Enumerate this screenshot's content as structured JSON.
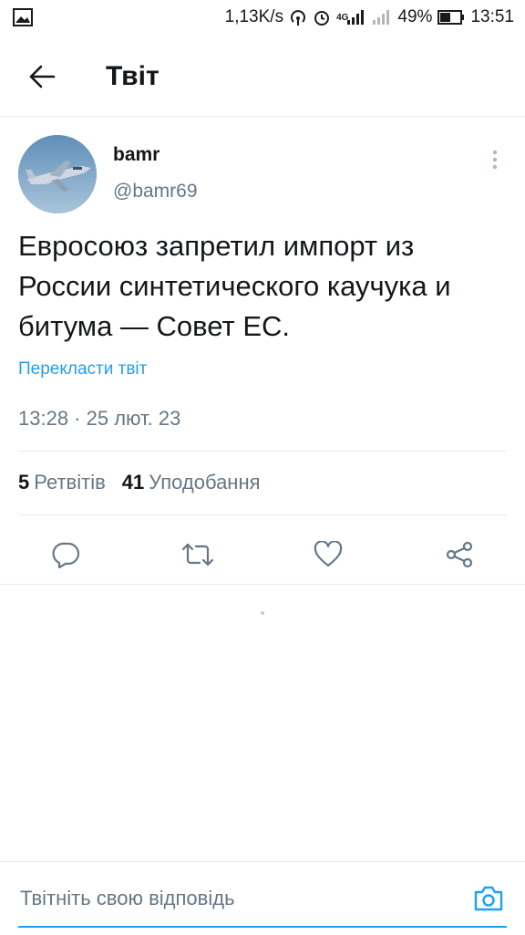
{
  "status_bar": {
    "network_speed": "1,13K/s",
    "network_type": "4G",
    "battery_percent": "49%",
    "time": "13:51"
  },
  "header": {
    "title": "Твіт"
  },
  "tweet": {
    "author_name": "bamr",
    "author_handle": "@bamr69",
    "text": "Евросоюз запретил импорт из России синтетического каучука и битума — Совет ЕС.",
    "translate_label": "Перекласти твіт",
    "timestamp": "13:28 · 25 лют. 23",
    "retweet_count": "5",
    "retweet_label": "Ретвітів",
    "like_count": "41",
    "like_label": "Уподобання"
  },
  "actions": {
    "icons": [
      "reply-icon",
      "retweet-icon",
      "like-icon",
      "share-icon"
    ]
  },
  "reply": {
    "placeholder": "Твітніть свою відповідь",
    "value": ""
  },
  "colors": {
    "accent": "#1da1f2",
    "secondary_text": "#657786",
    "primary_text": "#14171a",
    "border": "#e6ecf0"
  }
}
